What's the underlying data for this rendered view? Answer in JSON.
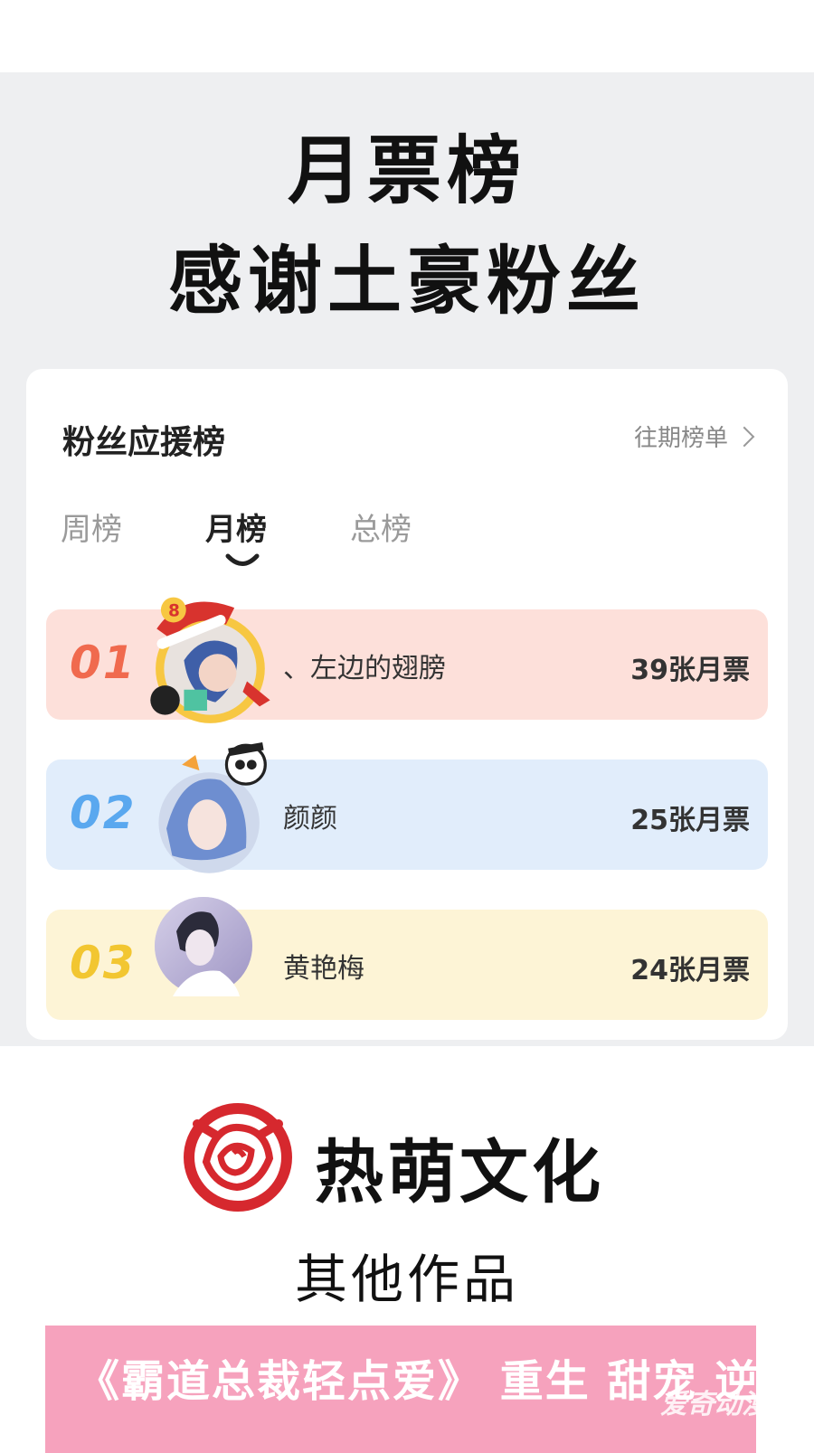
{
  "header": {
    "line1": "月票榜",
    "line2": "感谢土豪粉丝"
  },
  "card": {
    "title": "粉丝应援榜",
    "history_link": "往期榜单",
    "tabs": [
      {
        "label": "周榜",
        "active": false
      },
      {
        "label": "月榜",
        "active": true
      },
      {
        "label": "总榜",
        "active": false
      }
    ],
    "ranks": [
      {
        "rank": "01",
        "name": "、左边的翅膀",
        "tickets": "39张月票",
        "color": "#f06a4e",
        "bg": "#fde0da"
      },
      {
        "rank": "02",
        "name": "颜颜",
        "tickets": "25张月票",
        "color": "#5aa8ef",
        "bg": "#e1edfb"
      },
      {
        "rank": "03",
        "name": "黄艳梅",
        "tickets": "24张月票",
        "color": "#f2c631",
        "bg": "#fdf4d6"
      }
    ]
  },
  "footer": {
    "brand": "热萌文化",
    "other_works": "其他作品",
    "promo": "《霸道总裁轻点爱》  重生  甜宠  逆袭",
    "watermark": "爱奇动漫",
    "brand_color": "#d6282e",
    "promo_bg": "#f6a2bd"
  }
}
